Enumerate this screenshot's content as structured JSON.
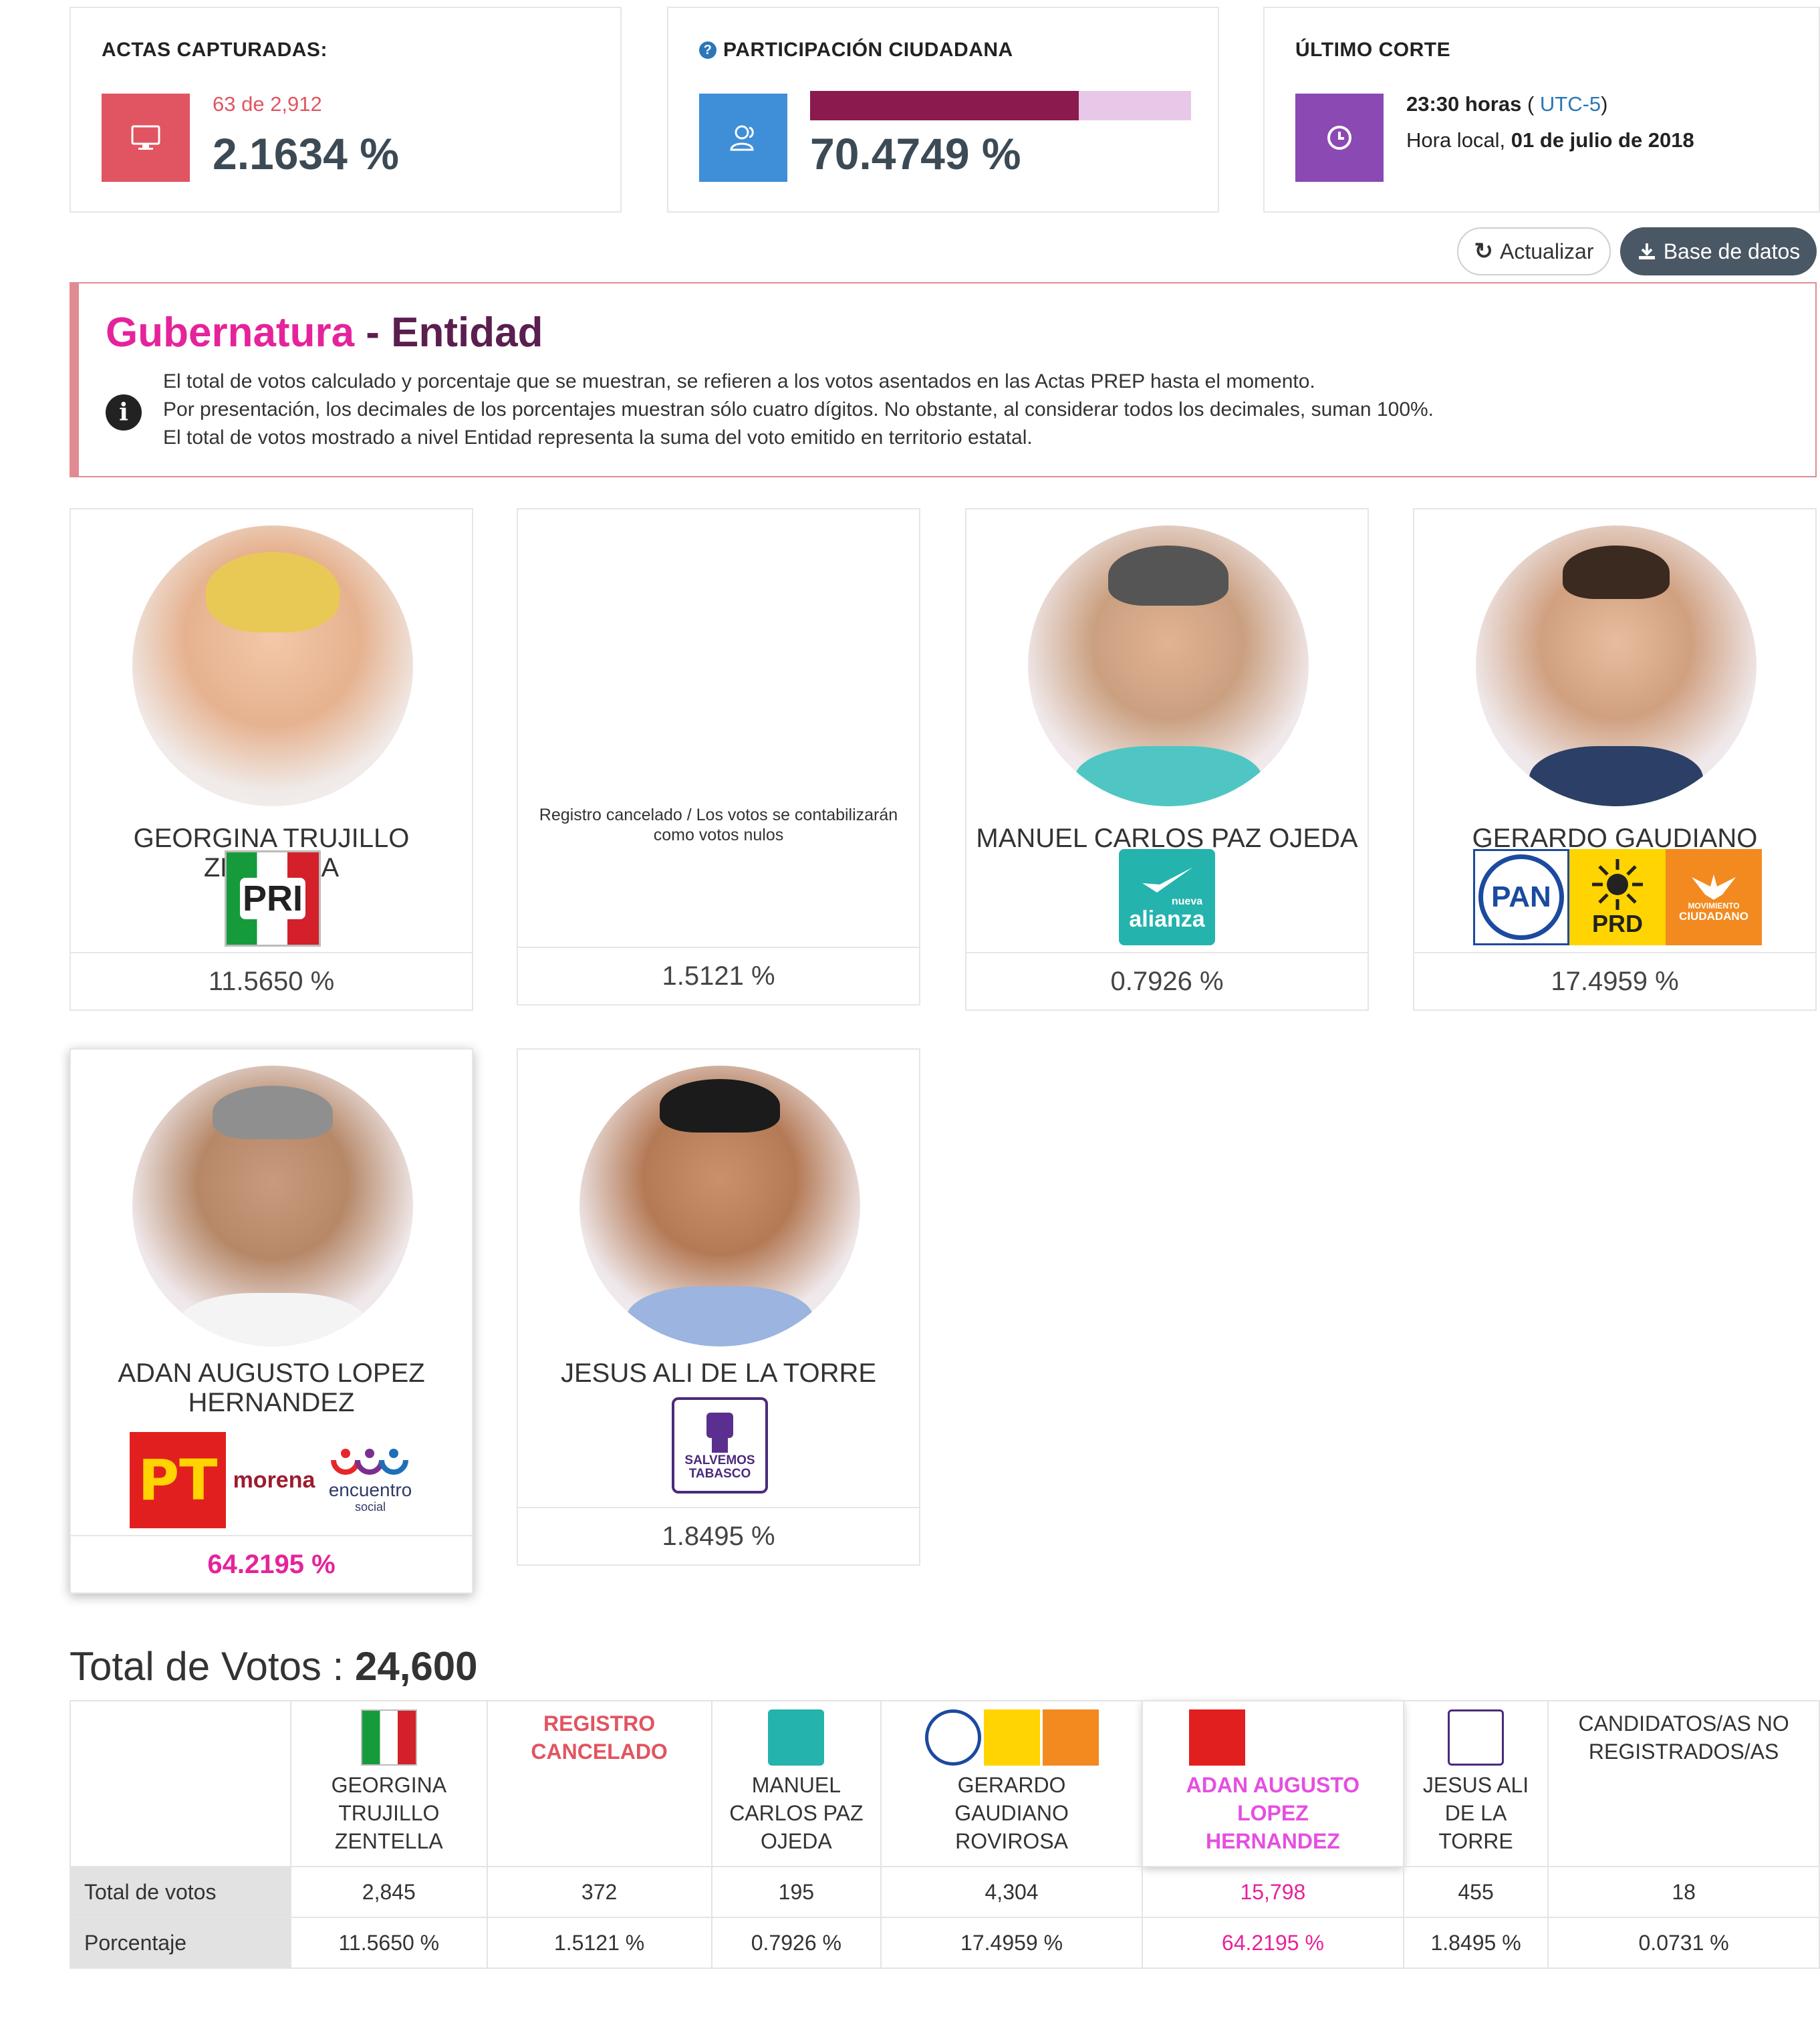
{
  "summary": {
    "actas": {
      "title": "ACTAS CAPTURADAS:",
      "count_text": "63 de 2,912",
      "percent": "2.1634 %"
    },
    "participacion": {
      "title": "PARTICIPACIÓN CIUDADANA",
      "percent": "70.4749 %",
      "fill_fraction": 0.7047
    },
    "corte": {
      "title": "ÚLTIMO CORTE",
      "time": "23:30 horas",
      "tz_open": "( ",
      "tz": "UTC-5",
      "tz_close": ")",
      "local_prefix": "Hora local, ",
      "date": "01 de julio de 2018"
    }
  },
  "buttons": {
    "refresh": "Actualizar",
    "database": "Base de datos"
  },
  "section": {
    "title_main": "Gubernatura",
    "title_sep": " - ",
    "title_sub": "Entidad",
    "notes": [
      "El total de votos calculado y porcentaje que se muestran, se refieren a los votos asentados en las Actas PREP hasta el momento.",
      "Por presentación, los decimales de los porcentajes muestran sólo cuatro dígitos. No obstante, al considerar todos los decimales, suman 100%.",
      "El total de votos mostrado a nivel Entidad representa la suma del voto emitido en territorio estatal."
    ]
  },
  "candidates": [
    {
      "name": "GEORGINA TRUJILLO ZENTELLA",
      "percent": "11.5650 %",
      "parties": [
        "PRI"
      ]
    },
    {
      "name": "Registro cancelado / Los votos se contabilizarán como votos nulos",
      "percent": "1.5121 %",
      "parties": []
    },
    {
      "name": "MANUEL CARLOS PAZ OJEDA",
      "percent": "0.7926 %",
      "parties": [
        "nueva alianza"
      ]
    },
    {
      "name": "GERARDO GAUDIANO ROVIROSA",
      "percent": "17.4959 %",
      "parties": [
        "PAN",
        "PRD",
        "MOVIMIENTO CIUDADANO"
      ]
    },
    {
      "name": "ADAN AUGUSTO LOPEZ HERNANDEZ",
      "percent": "64.2195 %",
      "parties": [
        "PT",
        "morena",
        "encuentro social"
      ]
    },
    {
      "name": "JESUS ALI DE LA TORRE",
      "percent": "1.8495 %",
      "parties": [
        "SALVEMOS TABASCO"
      ]
    }
  ],
  "logos": {
    "pri": "PRI",
    "pan": "PAN",
    "prd": "PRD",
    "mc_1": "MOVIMIENTO",
    "mc_2": "CIUDADANO",
    "alianza_top": "nueva",
    "alianza": "alianza",
    "pt": "PT",
    "morena": "morena",
    "encuentro": "encuentro",
    "social": "social",
    "salvemos_1": "SALVEMOS",
    "salvemos_2": "TABASCO"
  },
  "totals": {
    "label": "Total de Votos : ",
    "value": "24,600"
  },
  "table": {
    "headers": [
      "GEORGINA TRUJILLO ZENTELLA",
      "REGISTRO CANCELADO",
      "MANUEL CARLOS PAZ OJEDA",
      "GERARDO GAUDIANO ROVIROSA",
      "ADAN AUGUSTO LOPEZ HERNANDEZ",
      "JESUS ALI DE LA TORRE",
      "CANDIDATOS/AS NO REGISTRADOS/AS"
    ],
    "row_votes_label": "Total de votos",
    "votes": [
      "2,845",
      "372",
      "195",
      "4,304",
      "15,798",
      "455",
      "18"
    ],
    "row_pct_label": "Porcentaje",
    "percents": [
      "11.5650 %",
      "1.5121 %",
      "0.7926 %",
      "17.4959 %",
      "64.2195 %",
      "1.8495 %",
      "0.0731 %"
    ]
  },
  "colors": {
    "actas": "#e05561",
    "participacion": "#3e8ed8",
    "corte": "#8b49b3",
    "title_pink": "#e5239b",
    "title_dark": "#5a1f4e",
    "bar_fill": "#8b1b4f",
    "bar_bg": "#e8c8e8"
  }
}
